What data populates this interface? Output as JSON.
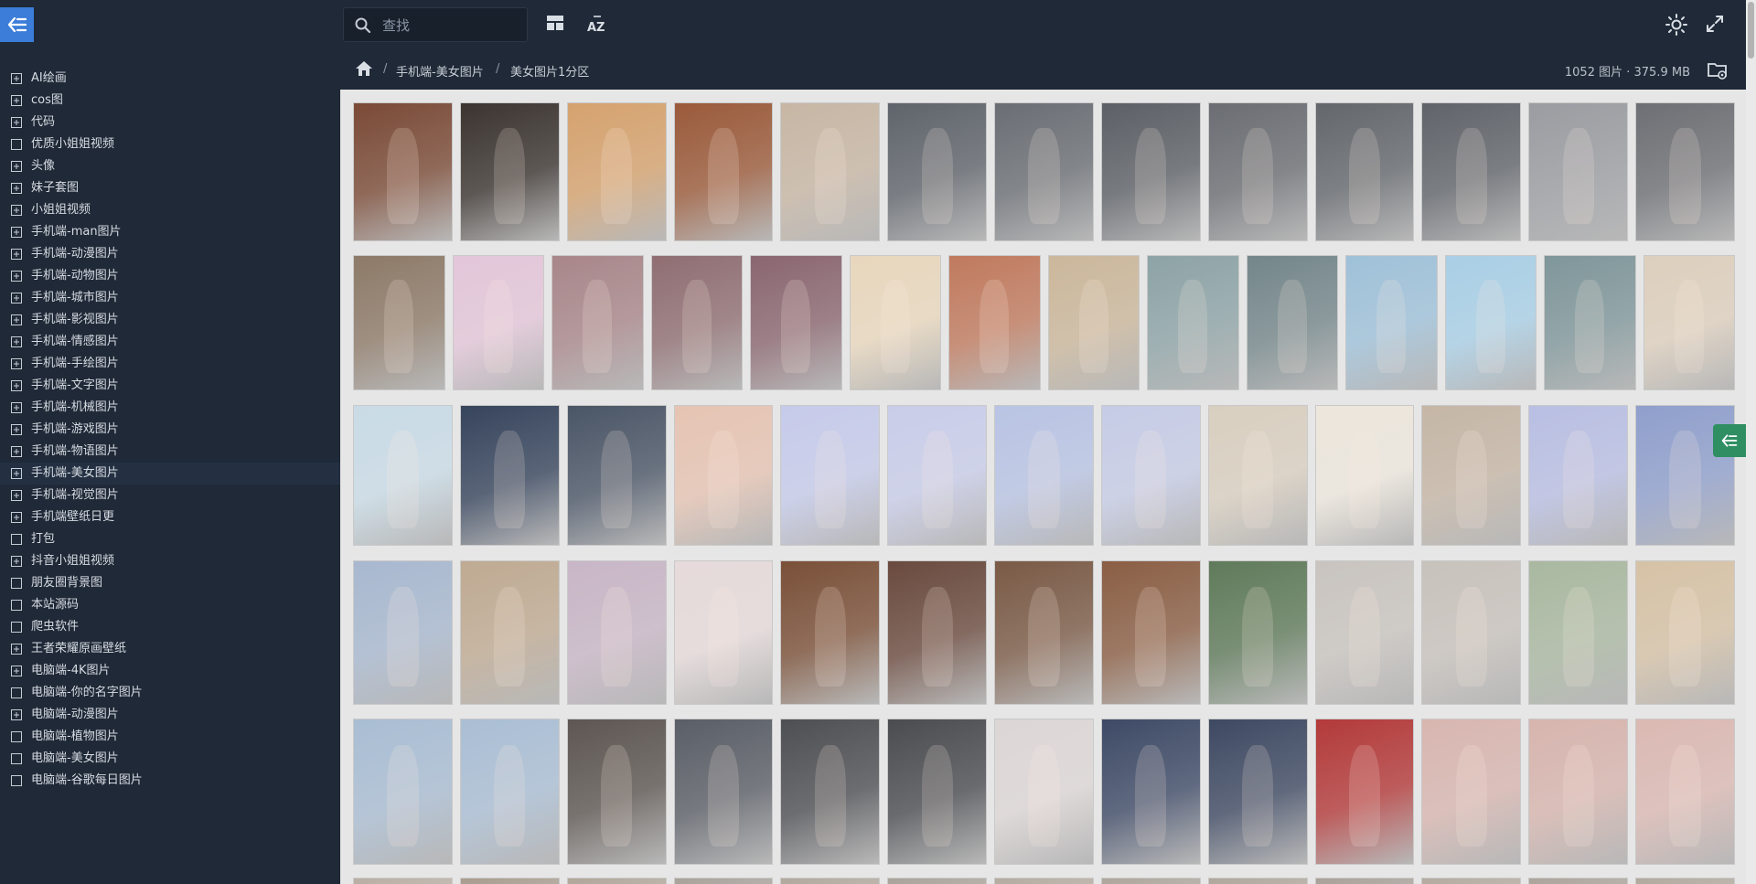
{
  "topbar": {
    "search_placeholder": "查找",
    "search_value": "",
    "sort_label": "AZ"
  },
  "sidebar": {
    "items": [
      {
        "label": "AI绘画",
        "icon": "folder-plus-icon"
      },
      {
        "label": "cos图",
        "icon": "folder-plus-icon"
      },
      {
        "label": "代码",
        "icon": "folder-plus-icon"
      },
      {
        "label": "优质小姐姐视频",
        "icon": "folder-icon"
      },
      {
        "label": "头像",
        "icon": "folder-plus-icon"
      },
      {
        "label": "妹子套图",
        "icon": "folder-plus-icon"
      },
      {
        "label": "小姐姐视频",
        "icon": "folder-plus-icon"
      },
      {
        "label": "手机端-man图片",
        "icon": "folder-plus-icon"
      },
      {
        "label": "手机端-动漫图片",
        "icon": "folder-plus-icon"
      },
      {
        "label": "手机端-动物图片",
        "icon": "folder-plus-icon"
      },
      {
        "label": "手机端-城市图片",
        "icon": "folder-plus-icon"
      },
      {
        "label": "手机端-影视图片",
        "icon": "folder-plus-icon"
      },
      {
        "label": "手机端-情感图片",
        "icon": "folder-plus-icon"
      },
      {
        "label": "手机端-手绘图片",
        "icon": "folder-plus-icon"
      },
      {
        "label": "手机端-文字图片",
        "icon": "folder-plus-icon"
      },
      {
        "label": "手机端-机械图片",
        "icon": "folder-plus-icon"
      },
      {
        "label": "手机端-游戏图片",
        "icon": "folder-plus-icon"
      },
      {
        "label": "手机端-物语图片",
        "icon": "folder-plus-icon"
      },
      {
        "label": "手机端-美女图片",
        "icon": "folder-plus-icon",
        "active": true
      },
      {
        "label": "手机端-视觉图片",
        "icon": "folder-plus-icon"
      },
      {
        "label": "手机端壁纸日更",
        "icon": "folder-plus-icon"
      },
      {
        "label": "打包",
        "icon": "folder-icon"
      },
      {
        "label": "抖音小姐姐视频",
        "icon": "folder-plus-icon"
      },
      {
        "label": "朋友圈背景图",
        "icon": "folder-icon"
      },
      {
        "label": "本站源码",
        "icon": "folder-icon"
      },
      {
        "label": "爬虫软件",
        "icon": "folder-icon"
      },
      {
        "label": "王者荣耀原画壁纸",
        "icon": "folder-plus-icon"
      },
      {
        "label": "电脑端-4K图片",
        "icon": "folder-plus-icon"
      },
      {
        "label": "电脑端-你的名字图片",
        "icon": "folder-icon"
      },
      {
        "label": "电脑端-动漫图片",
        "icon": "folder-plus-icon"
      },
      {
        "label": "电脑端-植物图片",
        "icon": "folder-icon"
      },
      {
        "label": "电脑端-美女图片",
        "icon": "folder-icon"
      },
      {
        "label": "电脑端-谷歌每日图片",
        "icon": "folder-icon"
      }
    ]
  },
  "breadcrumb": {
    "home_icon": "home-icon",
    "separator": "/",
    "items": [
      "手机端-美女图片",
      "美女图片1分区"
    ]
  },
  "stats": "1052 图片 · 375.9 MB",
  "colors": {
    "sidebar_bg": "#1f2937",
    "menu_button": "#3b7dd8",
    "side_toggle": "#2f8f63",
    "gallery_bg": "#e6e6e6"
  },
  "gallery": {
    "rows": [
      {
        "thumbs": [
          {
            "color": "#7a4a36",
            "label": "thumbnail"
          },
          {
            "color": "#3b3430",
            "label": "thumbnail"
          },
          {
            "color": "#d5a26e",
            "label": "thumbnail"
          },
          {
            "color": "#9a5a3a",
            "label": "thumbnail"
          },
          {
            "color": "#c7b6a4",
            "label": "thumbnail"
          },
          {
            "color": "#5f646b",
            "label": "thumbnail"
          },
          {
            "color": "#6a6e74",
            "label": "thumbnail"
          },
          {
            "color": "#5c6066",
            "label": "thumbnail"
          },
          {
            "color": "#6a6d72",
            "label": "thumbnail"
          },
          {
            "color": "#63676c",
            "label": "thumbnail"
          },
          {
            "color": "#60646a",
            "label": "thumbnail"
          },
          {
            "color": "#9a9ca1",
            "label": "thumbnail"
          },
          {
            "color": "#6d6f74",
            "label": "thumbnail"
          }
        ]
      },
      {
        "thumbs": [
          {
            "color": "#8d7a68",
            "label": "thumbnail"
          },
          {
            "color": "#e3c6d9",
            "label": "thumbnail"
          },
          {
            "color": "#a8868a",
            "label": "thumbnail"
          },
          {
            "color": "#8f6e72",
            "label": "thumbnail"
          },
          {
            "color": "#8a6670",
            "label": "thumbnail"
          },
          {
            "color": "#e8d7bd",
            "label": "thumbnail"
          },
          {
            "color": "#c07a5e",
            "label": "thumbnail"
          },
          {
            "color": "#cbb79b",
            "label": "thumbnail"
          },
          {
            "color": "#8da3a6",
            "label": "thumbnail"
          },
          {
            "color": "#74868a",
            "label": "thumbnail"
          },
          {
            "color": "#9fc1d9",
            "label": "thumbnail"
          },
          {
            "color": "#a9cfe6",
            "label": "thumbnail"
          },
          {
            "color": "#7f969a",
            "label": "thumbnail"
          },
          {
            "color": "#ddcfbd",
            "label": "thumbnail"
          }
        ]
      },
      {
        "thumbs": [
          {
            "color": "#c9dbe6",
            "label": "thumbnail"
          },
          {
            "color": "#36445c",
            "label": "thumbnail"
          },
          {
            "color": "#4a5566",
            "label": "thumbnail"
          },
          {
            "color": "#e6c4b3",
            "label": "thumbnail"
          },
          {
            "color": "#c6cbea",
            "label": "thumbnail"
          },
          {
            "color": "#c9cde9",
            "label": "thumbnail"
          },
          {
            "color": "#b9c4e4",
            "label": "thumbnail"
          },
          {
            "color": "#c6cce6",
            "label": "thumbnail"
          },
          {
            "color": "#d9cfc0",
            "label": "thumbnail"
          },
          {
            "color": "#ece6dc",
            "label": "thumbnail"
          },
          {
            "color": "#c5b6a6",
            "label": "thumbnail"
          },
          {
            "color": "#b9bfe3",
            "label": "thumbnail"
          },
          {
            "color": "#8f9fcc",
            "label": "thumbnail"
          }
        ]
      },
      {
        "thumbs": [
          {
            "color": "#a8b8cf",
            "label": "thumbnail"
          },
          {
            "color": "#bfaa92",
            "label": "thumbnail"
          },
          {
            "color": "#c8b6c6",
            "label": "thumbnail"
          },
          {
            "color": "#e6dada",
            "label": "thumbnail"
          },
          {
            "color": "#7a5038",
            "label": "thumbnail"
          },
          {
            "color": "#6a4a3e",
            "label": "thumbnail"
          },
          {
            "color": "#7a5a46",
            "label": "thumbnail"
          },
          {
            "color": "#8a5e44",
            "label": "thumbnail"
          },
          {
            "color": "#5f7a5a",
            "label": "thumbnail"
          },
          {
            "color": "#c9c4bf",
            "label": "thumbnail"
          },
          {
            "color": "#c8c2bc",
            "label": "thumbnail"
          },
          {
            "color": "#a9b8a0",
            "label": "thumbnail"
          },
          {
            "color": "#d6c2a6",
            "label": "thumbnail"
          }
        ]
      },
      {
        "thumbs": [
          {
            "color": "#a9bdd3",
            "label": "thumbnail"
          },
          {
            "color": "#aabed4",
            "label": "thumbnail"
          },
          {
            "color": "#5d5652",
            "label": "thumbnail"
          },
          {
            "color": "#5a5e66",
            "label": "thumbnail"
          },
          {
            "color": "#4e4f53",
            "label": "thumbnail"
          },
          {
            "color": "#4a4c50",
            "label": "thumbnail"
          },
          {
            "color": "#ddd6d6",
            "label": "thumbnail"
          },
          {
            "color": "#3e4a66",
            "label": "thumbnail"
          },
          {
            "color": "#3e4962",
            "label": "thumbnail"
          },
          {
            "color": "#b33a3a",
            "label": "thumbnail"
          },
          {
            "color": "#d8b6b0",
            "label": "thumbnail"
          },
          {
            "color": "#d7b5ae",
            "label": "thumbnail"
          },
          {
            "color": "#dbb9b3",
            "label": "thumbnail"
          }
        ]
      },
      {
        "thumbs": [
          {
            "color": "#b9aea3",
            "label": "thumbnail"
          },
          {
            "color": "#a99c8f",
            "label": "thumbnail"
          },
          {
            "color": "#b1a69a",
            "label": "thumbnail"
          },
          {
            "color": "#a8a29a",
            "label": "thumbnail"
          },
          {
            "color": "#b2a89d",
            "label": "thumbnail"
          },
          {
            "color": "#aaa39a",
            "label": "thumbnail"
          },
          {
            "color": "#b5aba0",
            "label": "thumbnail"
          },
          {
            "color": "#aea69c",
            "label": "thumbnail"
          },
          {
            "color": "#b0a79c",
            "label": "thumbnail"
          },
          {
            "color": "#a9a199",
            "label": "thumbnail"
          },
          {
            "color": "#b4aa9f",
            "label": "thumbnail"
          },
          {
            "color": "#aca49b",
            "label": "thumbnail"
          },
          {
            "color": "#b2a99e",
            "label": "thumbnail"
          }
        ]
      }
    ]
  }
}
